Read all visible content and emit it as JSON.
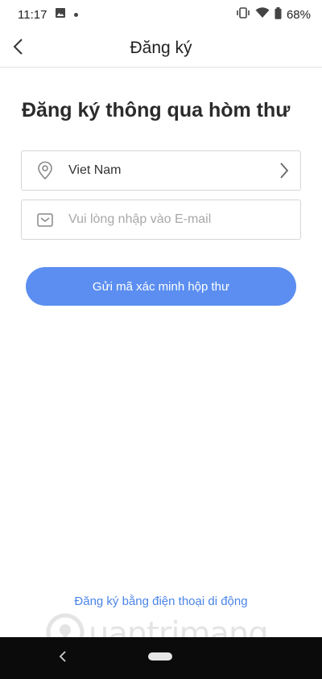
{
  "status_bar": {
    "time": "11:17",
    "battery": "68%"
  },
  "app_bar": {
    "title": "Đăng ký"
  },
  "main": {
    "heading": "Đăng ký thông qua hòm thư",
    "country": {
      "value": "Viet Nam"
    },
    "email": {
      "placeholder": "Vui lòng nhập vào E-mail"
    },
    "submit_label": "Gửi mã xác minh hộp thư",
    "alt_link": "Đăng ký bằng điện thoại di động"
  },
  "watermark": {
    "text": "uantrimang"
  },
  "colors": {
    "accent": "#5b8ef0",
    "link": "#4a84e8",
    "nav_bar": "#0b0b0b"
  }
}
